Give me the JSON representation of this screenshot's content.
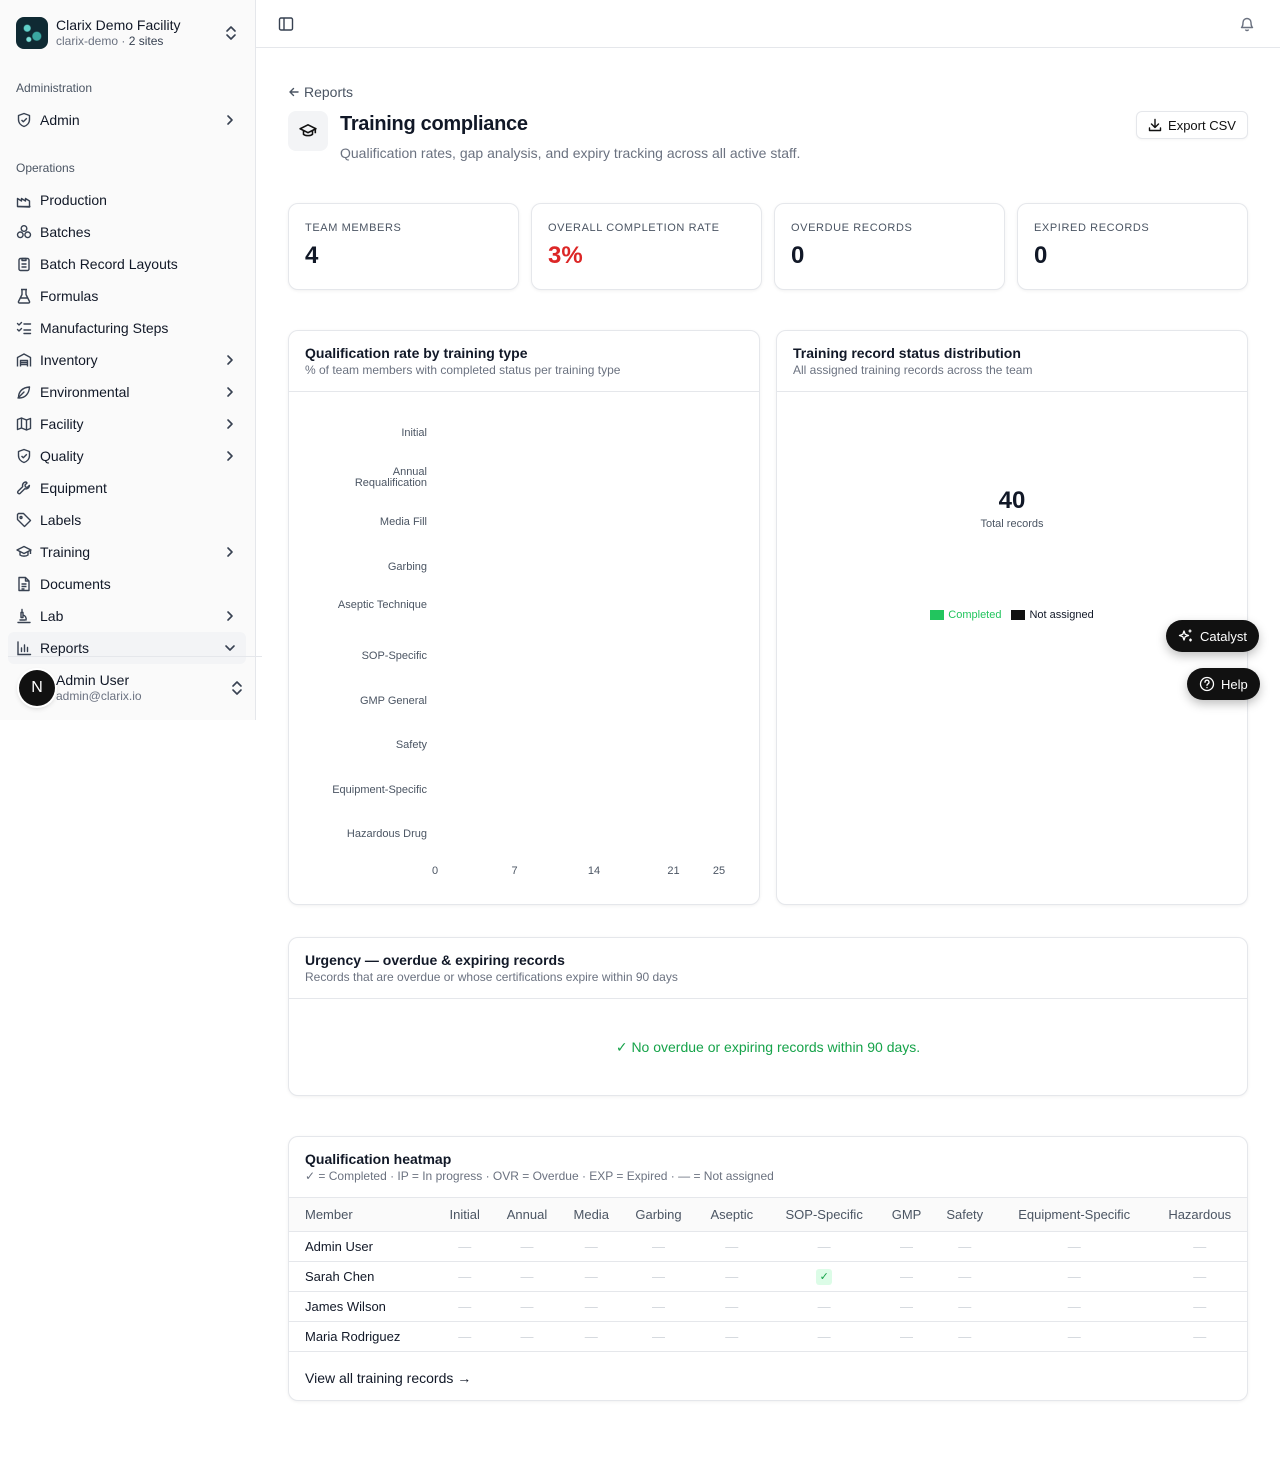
{
  "org": {
    "name": "Clarix Demo Facility",
    "slug": "clarix-demo",
    "sites": "2 sites",
    "separator": "·"
  },
  "sidebar": {
    "admin_section": "Administration",
    "admin_items": [
      {
        "label": "Admin",
        "icon": "shield-check-icon",
        "has_chevron": true
      }
    ],
    "ops_section": "Operations",
    "items": [
      {
        "label": "Production",
        "icon": "factory-icon"
      },
      {
        "label": "Batches",
        "icon": "boxes-icon"
      },
      {
        "label": "Batch Record Layouts",
        "icon": "clipboard-icon"
      },
      {
        "label": "Formulas",
        "icon": "flask-icon"
      },
      {
        "label": "Manufacturing Steps",
        "icon": "list-checks-icon"
      },
      {
        "label": "Inventory",
        "icon": "warehouse-icon",
        "has_chevron": true
      },
      {
        "label": "Environmental",
        "icon": "leaf-icon",
        "has_chevron": true
      },
      {
        "label": "Facility",
        "icon": "map-icon",
        "has_chevron": true
      },
      {
        "label": "Quality",
        "icon": "shield-check-icon",
        "has_chevron": true
      },
      {
        "label": "Equipment",
        "icon": "wrench-icon"
      },
      {
        "label": "Labels",
        "icon": "tag-icon"
      },
      {
        "label": "Training",
        "icon": "graduation-cap-icon",
        "has_chevron": true
      },
      {
        "label": "Documents",
        "icon": "file-text-icon"
      },
      {
        "label": "Lab",
        "icon": "microscope-icon",
        "has_chevron": true
      },
      {
        "label": "Reports",
        "icon": "bar-chart-icon",
        "expanded": true
      }
    ]
  },
  "user": {
    "initial": "N",
    "name": "Admin User",
    "email": "admin@clarix.io"
  },
  "page": {
    "back_label": "Reports",
    "title": "Training compliance",
    "description": "Qualification rates, gap analysis, and expiry tracking across all active staff.",
    "export_label": "Export CSV"
  },
  "stats": [
    {
      "label": "Team members",
      "value": "4"
    },
    {
      "label": "Overall completion rate",
      "value": "3%",
      "color": "#dc2626"
    },
    {
      "label": "Overdue records",
      "value": "0"
    },
    {
      "label": "Expired records",
      "value": "0"
    }
  ],
  "qual_card": {
    "title": "Qualification rate by training type",
    "subtitle": "% of team members with completed status per training type"
  },
  "status_card": {
    "title": "Training record status distribution",
    "subtitle": "All assigned training records across the team"
  },
  "urgency_card": {
    "title": "Urgency — overdue & expiring records",
    "subtitle": "Records that are overdue or whose certifications expire within 90 days",
    "empty_message": "✓ No overdue or expiring records within 90 days."
  },
  "heatmap": {
    "title": "Qualification heatmap",
    "subtitle": "✓ = Completed · IP = In progress · OVR = Overdue · EXP = Expired · — = Not assigned",
    "columns": [
      "Member",
      "Initial",
      "Annual",
      "Media",
      "Garbing",
      "Aseptic",
      "SOP-Specific",
      "GMP",
      "Safety",
      "Equipment-Specific",
      "Hazardous"
    ],
    "rows": [
      {
        "member": "Admin User",
        "cells": [
          "—",
          "—",
          "—",
          "—",
          "—",
          "—",
          "—",
          "—",
          "—",
          "—"
        ]
      },
      {
        "member": "Sarah Chen",
        "cells": [
          "—",
          "—",
          "—",
          "—",
          "—",
          "✓",
          "—",
          "—",
          "—",
          "—"
        ]
      },
      {
        "member": "James Wilson",
        "cells": [
          "—",
          "—",
          "—",
          "—",
          "—",
          "—",
          "—",
          "—",
          "—",
          "—"
        ]
      },
      {
        "member": "Maria Rodriguez",
        "cells": [
          "—",
          "—",
          "—",
          "—",
          "—",
          "—",
          "—",
          "—",
          "—",
          "—"
        ]
      }
    ],
    "view_all_label": "View all training records →"
  },
  "floating": {
    "catalyst_label": "Catalyst",
    "help_label": "Help"
  },
  "colors": {
    "completed": "#22c55e",
    "not_assigned": "#111111",
    "danger": "#dc2626",
    "success": "#16a34a"
  },
  "chart_data": [
    {
      "type": "bar",
      "orientation": "horizontal",
      "categories": [
        "Initial",
        "Annual Requalification",
        "Media Fill",
        "Garbing",
        "Aseptic Technique",
        "SOP-Specific",
        "GMP General",
        "Safety",
        "Equipment-Specific",
        "Hazardous Drug"
      ],
      "values": [
        0,
        0,
        0,
        0,
        0,
        0,
        0,
        0,
        0,
        0
      ],
      "xticks": [
        "0",
        "7",
        "14",
        "21",
        "25"
      ],
      "xlim": [
        0,
        25
      ]
    },
    {
      "type": "pie",
      "total": "40",
      "total_label": "Total records",
      "legend": [
        "Completed",
        "Not assigned"
      ],
      "legend_position": "bottom"
    }
  ]
}
